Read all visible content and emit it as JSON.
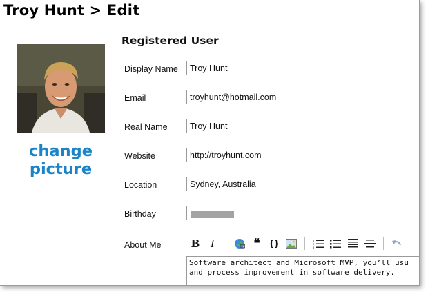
{
  "page": {
    "title": "Troy Hunt > Edit"
  },
  "profile": {
    "change_picture_line1": "change",
    "change_picture_line2": "picture"
  },
  "form": {
    "section_title": "Registered User",
    "display_name": {
      "label": "Display Name",
      "value": "Troy Hunt"
    },
    "email": {
      "label": "Email",
      "value": "troyhunt@hotmail.com"
    },
    "real_name": {
      "label": "Real Name",
      "value": "Troy Hunt"
    },
    "website": {
      "label": "Website",
      "value": "http://troyhunt.com"
    },
    "location": {
      "label": "Location",
      "value": "Sydney, Australia"
    },
    "birthday": {
      "label": "Birthday",
      "value_redacted": true
    },
    "about_me": {
      "label": "About Me",
      "text_line1": "Software architect and Microsoft MVP, you’ll usu",
      "text_line2": "and process improvement in software delivery."
    }
  },
  "toolbar": {
    "bold": "B",
    "italic": "I",
    "quote": "❝",
    "code": "{}",
    "icons": [
      "bold-icon",
      "italic-icon",
      "link-icon",
      "quote-icon",
      "code-icon",
      "image-icon",
      "numbered-list-icon",
      "bulleted-list-icon",
      "heading-icon",
      "horizontal-rule-icon",
      "undo-icon"
    ]
  },
  "colors": {
    "accent": "#1a84c7",
    "border": "#9a9a9a"
  }
}
